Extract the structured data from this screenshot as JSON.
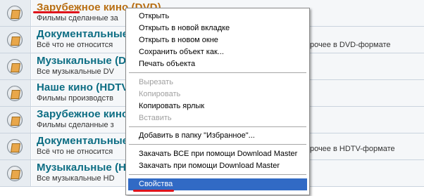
{
  "forums": [
    {
      "title": "Зарубежное кино (DVD)",
      "desc": "Фильмы сделанные за",
      "visited": true
    },
    {
      "title": "Документальные",
      "desc": "Всё что не относится",
      "visited": false
    },
    {
      "title": "Музыкальные (D",
      "desc": "Все музыкальные DV",
      "visited": false
    },
    {
      "title": "Наше кино (HDTV",
      "desc": "Фильмы производств",
      "visited": false
    },
    {
      "title": "Зарубежное кино",
      "desc": "Фильмы сделанные з",
      "visited": false
    },
    {
      "title": "Документальные",
      "desc": "Всё что не относится",
      "visited": false
    },
    {
      "title": "Музыкальные (H",
      "desc": "Все музыкальные HD",
      "visited": false
    }
  ],
  "desc_tails": {
    "row2": "прочее в DVD-формате",
    "row6": "прочее в HDTV-формате"
  },
  "context_menu": {
    "items": [
      {
        "label": "Открыть",
        "state": "enabled"
      },
      {
        "label": "Открыть в новой вкладке",
        "state": "enabled"
      },
      {
        "label": "Открыть в новом окне",
        "state": "enabled"
      },
      {
        "label": "Сохранить объект как...",
        "state": "enabled"
      },
      {
        "label": "Печать объекта",
        "state": "enabled"
      },
      {
        "label": "Вырезать",
        "state": "disabled"
      },
      {
        "label": "Копировать",
        "state": "disabled"
      },
      {
        "label": "Копировать ярлык",
        "state": "enabled"
      },
      {
        "label": "Вставить",
        "state": "disabled"
      },
      {
        "label": "Добавить в папку \"Избранное\"...",
        "state": "enabled"
      },
      {
        "label": "Закачать ВСЕ при помощи Download Master",
        "state": "enabled"
      },
      {
        "label": "Закачать при помощи Download Master",
        "state": "enabled"
      },
      {
        "label": "Свойства",
        "state": "selected"
      }
    ]
  },
  "colors": {
    "title_link": "#0c6d83",
    "title_visited": "#b86e12",
    "menu_highlight": "#316ac5",
    "annotation_red": "#e0131b"
  }
}
